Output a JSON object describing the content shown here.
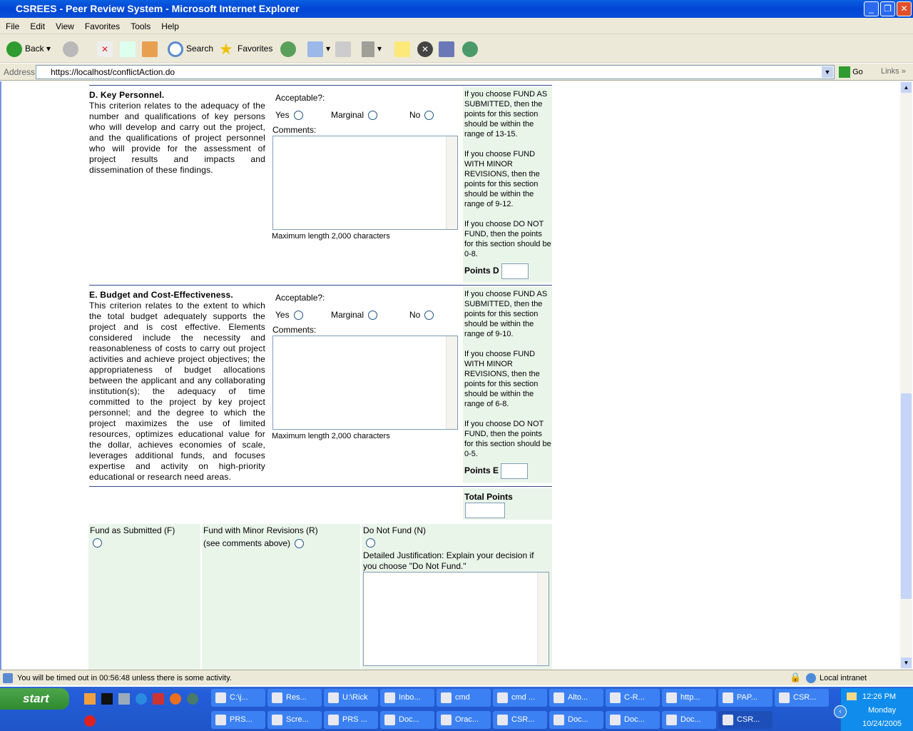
{
  "window": {
    "title": "CSREES - Peer Review System - Microsoft Internet Explorer"
  },
  "menu": [
    "File",
    "Edit",
    "View",
    "Favorites",
    "Tools",
    "Help"
  ],
  "toolbar": {
    "back": "Back",
    "search": "Search",
    "favorites": "Favorites"
  },
  "address": {
    "label": "Address",
    "url": "https://localhost/conflictAction.do",
    "go": "Go",
    "links": "Links"
  },
  "sections": [
    {
      "title": "D. Key Personnel.",
      "body": "This criterion relates to the adequacy of the number and qualifications of key persons who will develop and carry out the project, and the qualifications of project personnel who will provide for the assessment of project results and impacts and dissemination of these findings.",
      "acceptable": "Acceptable?:",
      "yes": "Yes",
      "marginal": "Marginal",
      "no": "No",
      "comments": "Comments:",
      "maxlen": "Maximum length 2,000 characters",
      "guide": [
        "If you choose FUND AS SUBMITTED, then the points for this section should be within the range of 13-15.",
        "If you choose FUND WITH MINOR REVISIONS, then the points for this section should be within the range of 9-12.",
        "If you choose DO NOT FUND, then the points for this section should be 0-8."
      ],
      "points": "Points D"
    },
    {
      "title": "E. Budget and Cost-Effectiveness.",
      "body": "This criterion relates to the extent to which the total budget adequately supports the project and is cost effective. Elements considered include the necessity and reasonableness of costs to carry out project activities and achieve project objectives; the appropriateness of budget allocations between the applicant and any collaborating institution(s); the adequacy of time committed to the project by key project personnel; and the degree to which the project maximizes the use of limited resources, optimizes educational value for the dollar, achieves economies of scale, leverages additional funds, and focuses expertise and activity on high-priority educational or research need areas.",
      "acceptable": "Acceptable?:",
      "yes": "Yes",
      "marginal": "Marginal",
      "no": "No",
      "comments": "Comments:",
      "maxlen": "Maximum length 2,000 characters",
      "guide": [
        "If you choose FUND AS SUBMITTED, then the points for this section should be within the range of 9-10.",
        "If you choose FUND WITH MINOR REVISIONS, then the points for this section should be within the range of 6-8.",
        "If you choose DO NOT FUND, then the points for this section should be 0-5."
      ],
      "points": "Points E"
    }
  ],
  "total": {
    "label": "Total Points"
  },
  "decision": {
    "fund": "Fund as Submitted (F)",
    "minor": "Fund with Minor Revisions (R)",
    "minor_note": "(see comments above)",
    "dnf": "Do Not Fund (N)",
    "justification": "Detailed Justification: Explain your decision if you choose \"Do Not Fund.\""
  },
  "status": {
    "text": "You will be timed out in 00:56:48 unless there is some activity.",
    "zone": "Local intranet"
  },
  "taskbar": {
    "start": "start",
    "row1": [
      "C:\\j...",
      "Res...",
      "U:\\Rick",
      "Inbo...",
      "cmd",
      "cmd ...",
      "Alto...",
      "C-R...",
      "http...",
      "PAP...",
      "CSR..."
    ],
    "row2": [
      "PRS...",
      "Scre...",
      "PRS ...",
      "Doc...",
      "Orac...",
      "CSR...",
      "Doc...",
      "Doc...",
      "Doc...",
      "CSR..."
    ],
    "clock": {
      "time": "12:26 PM",
      "day": "Monday",
      "date": "10/24/2005"
    }
  }
}
